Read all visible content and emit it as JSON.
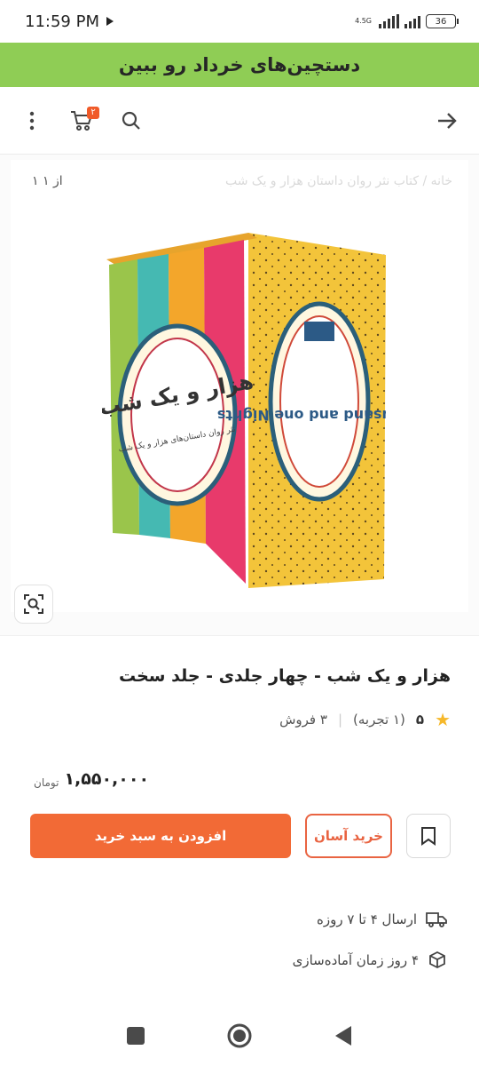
{
  "status": {
    "time": "11:59 PM",
    "network": "4.5G",
    "battery": "36"
  },
  "promo": {
    "text": "دستچین‌های خرداد رو ببین"
  },
  "toolbar": {
    "cart_count": "۲"
  },
  "gallery": {
    "breadcrumb": "خانه  /  کتاب نثر روان داستان هزار و یک شب",
    "counter": "۱ از ۱",
    "cover_title": "هزار و یک شب",
    "cover_subtitle": "نثر روان داستان‌های هزار و یک شب",
    "cover_english": "Thousand and one Nights"
  },
  "product": {
    "title": "هزار و یک شب - چهار جلدی - جلد سخت",
    "rating": "۵",
    "reviews": "(۱ تجربه)",
    "sales": "۳ فروش",
    "price": "۱,۵۵۰,۰۰۰",
    "currency": "تومان"
  },
  "actions": {
    "easy_buy": "خرید آسان",
    "add_to_cart": "افزودن به سبد خرید"
  },
  "shipping": {
    "delivery": "ارسال ۴ تا ۷ روزه",
    "prep": "۴ روز زمان آماده‌سازی"
  },
  "colors": {
    "promo": "#8fcd55",
    "accent": "#f26a36",
    "star": "#f6b82a"
  }
}
